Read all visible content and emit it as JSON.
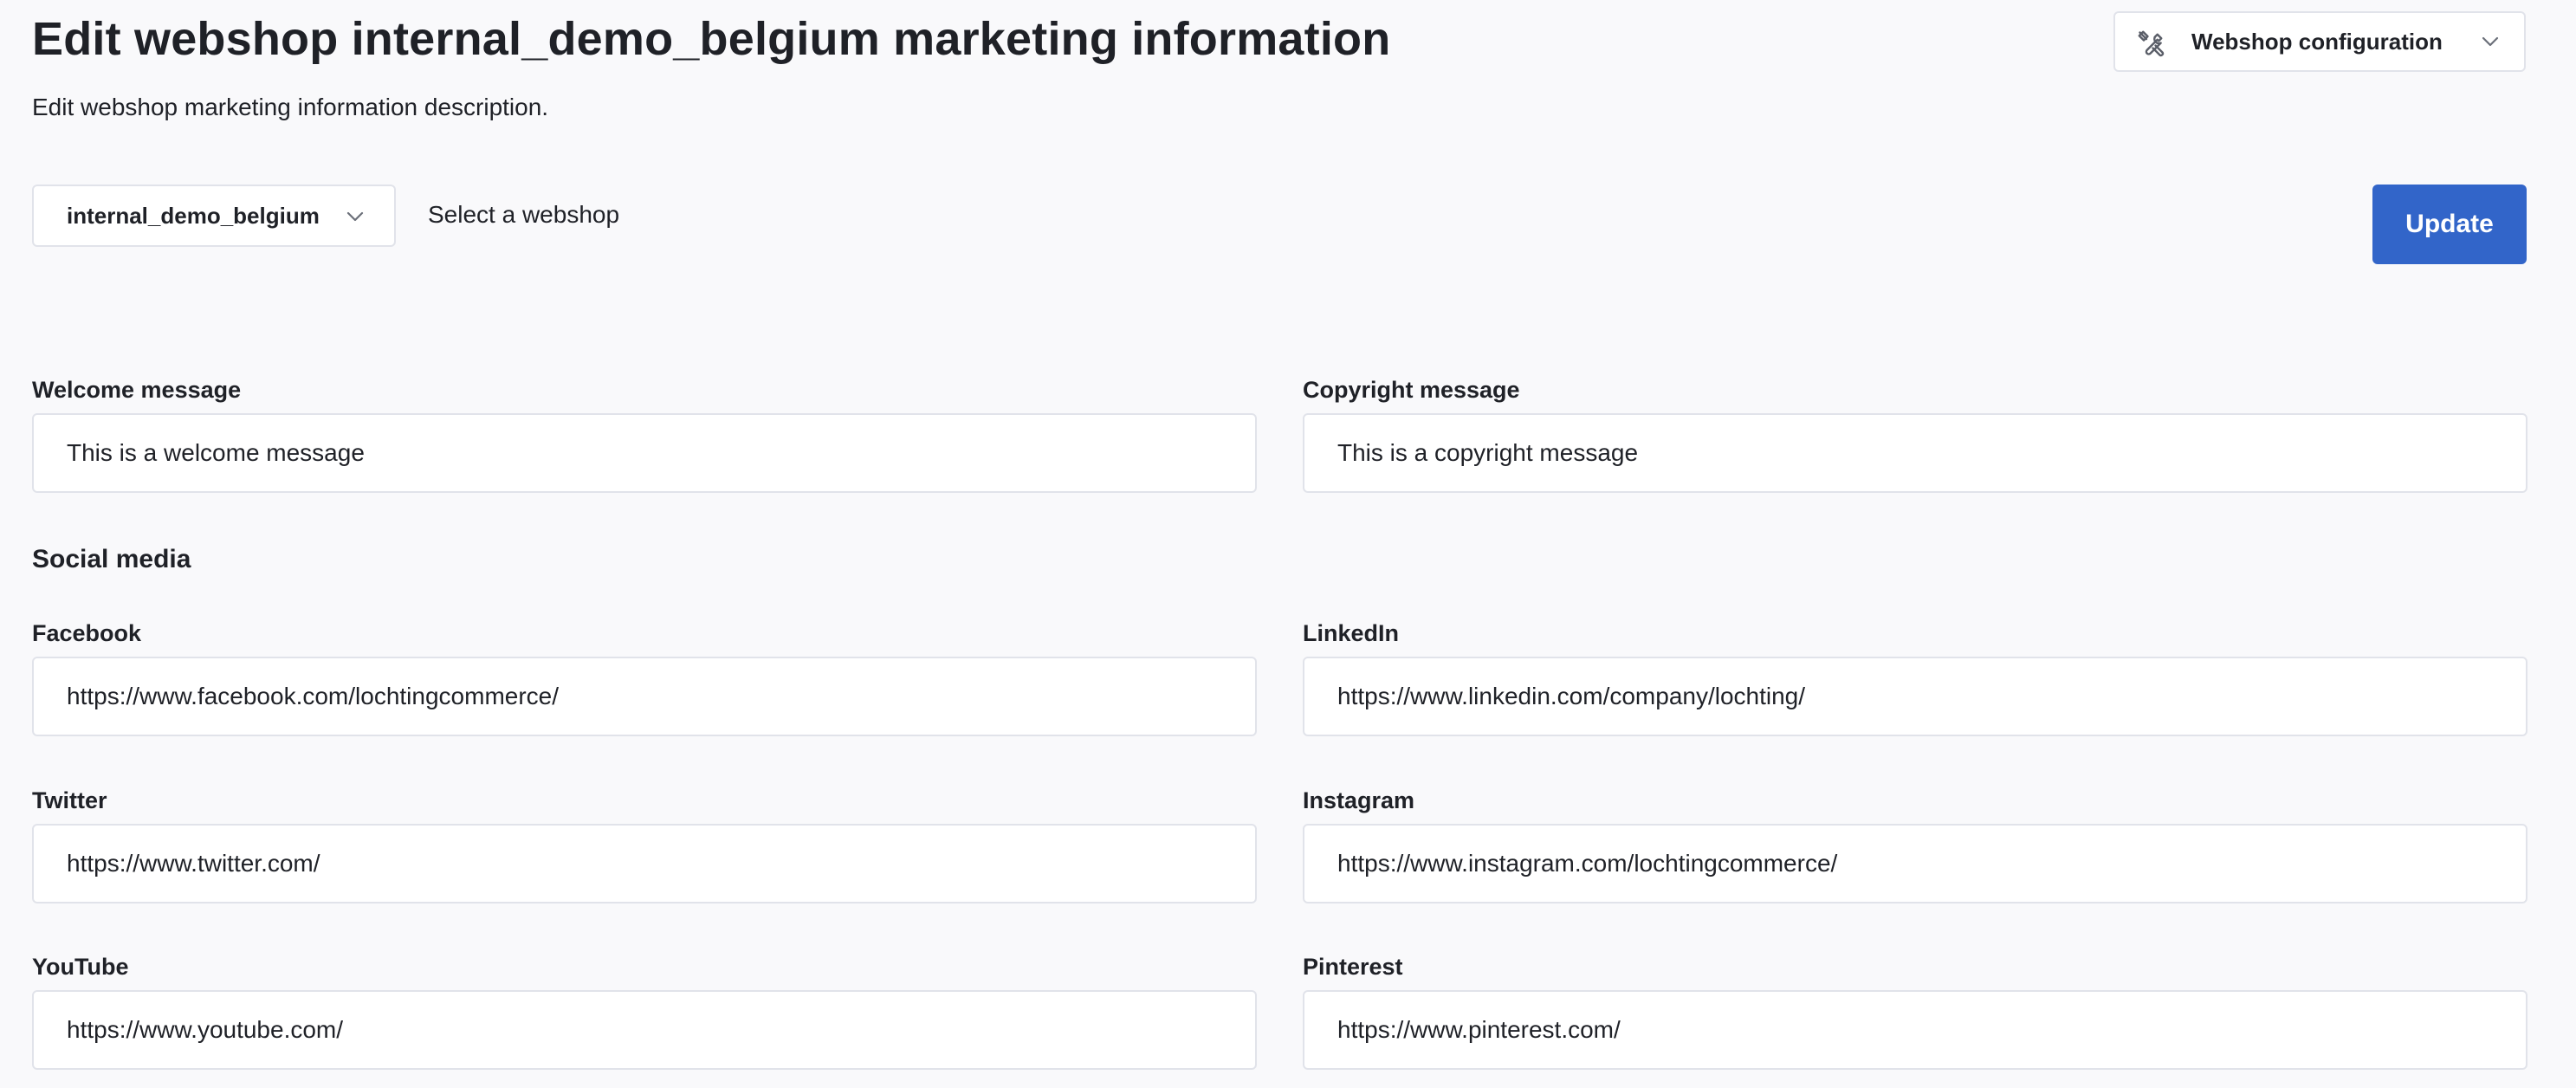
{
  "header": {
    "title": "Edit webshop internal_demo_belgium marketing information",
    "subtitle": "Edit webshop marketing information description."
  },
  "config_dropdown": {
    "label": "Webshop configuration",
    "icon": "tools-icon"
  },
  "webshop_selector": {
    "selected": "internal_demo_belgium",
    "hint": "Select a webshop"
  },
  "actions": {
    "update_label": "Update"
  },
  "fields": {
    "welcome": {
      "label": "Welcome message",
      "value": "This is a welcome message"
    },
    "copyright": {
      "label": "Copyright message",
      "value": "This is a copyright message"
    }
  },
  "social": {
    "heading": "Social media",
    "facebook": {
      "label": "Facebook",
      "value": "https://www.facebook.com/lochtingcommerce/"
    },
    "linkedin": {
      "label": "LinkedIn",
      "value": "https://www.linkedin.com/company/lochting/"
    },
    "twitter": {
      "label": "Twitter",
      "value": "https://www.twitter.com/"
    },
    "instagram": {
      "label": "Instagram",
      "value": "https://www.instagram.com/lochtingcommerce/"
    },
    "youtube": {
      "label": "YouTube",
      "value": "https://www.youtube.com/"
    },
    "pinterest": {
      "label": "Pinterest",
      "value": "https://www.pinterest.com/"
    }
  },
  "colors": {
    "accent": "#3265c9",
    "background": "#f9f9fb",
    "border": "#e1e3ea",
    "text": "#1f2127"
  }
}
